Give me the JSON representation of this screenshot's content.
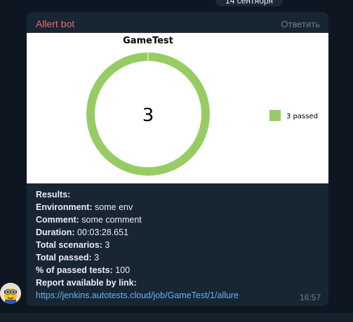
{
  "date_badge": "14 сентября",
  "message": {
    "sender": "Allert bot",
    "reply_label": "Ответить",
    "time": "16:57",
    "lines": [
      {
        "label": "Results:",
        "value": ""
      },
      {
        "label": "Environment:",
        "value": "some env"
      },
      {
        "label": "Comment:",
        "value": "some comment"
      },
      {
        "label": "Duration:",
        "value": "00:03:28.651"
      },
      {
        "label": "Total scenarios:",
        "value": "3"
      },
      {
        "label": "Total passed:",
        "value": "3"
      },
      {
        "label": "% of passed tests:",
        "value": "100"
      },
      {
        "label": "Report available by link:",
        "value": ""
      }
    ],
    "link": "https://jenkins.autotests.cloud/job/GameTest/1/allure"
  },
  "chart_data": {
    "type": "pie",
    "title": "GameTest",
    "center_label": "3",
    "slices": [
      {
        "name": "3 passed",
        "value": 3,
        "color": "#97cc64"
      }
    ],
    "legend_placement": "right"
  },
  "colors": {
    "passed": "#97cc64",
    "sender": "#e96a6a",
    "link": "#6ab3f3"
  }
}
